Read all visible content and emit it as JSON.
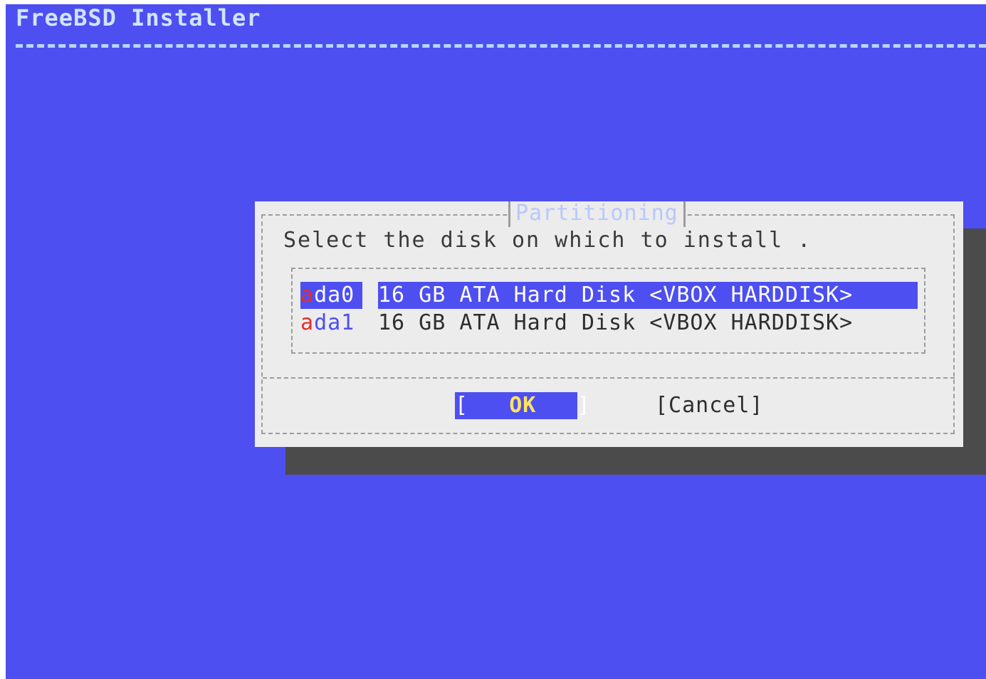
{
  "header": {
    "title": "FreeBSD Installer"
  },
  "dialog": {
    "title": "Partitioning",
    "prompt": "Select the disk on which to install .",
    "disks": [
      {
        "hotkey": "a",
        "name_rest": "da0",
        "description": "16 GB ATA Hard Disk <VBOX HARDDISK>",
        "selected": true
      },
      {
        "hotkey": "a",
        "name_rest": "da1",
        "description": "16 GB ATA Hard Disk <VBOX HARDDISK>",
        "selected": false
      }
    ],
    "buttons": {
      "ok": {
        "open": "[",
        "label": "OK",
        "close": "]"
      },
      "cancel": "[Cancel]"
    }
  },
  "colors": {
    "screen_background": "#4d4ff0",
    "dialog_background": "#ececec",
    "shadow": "#4b4b4b",
    "selection": "#4d4ff0",
    "hotkey": "#e0302a",
    "button_hotkey": "#ffe45c"
  }
}
